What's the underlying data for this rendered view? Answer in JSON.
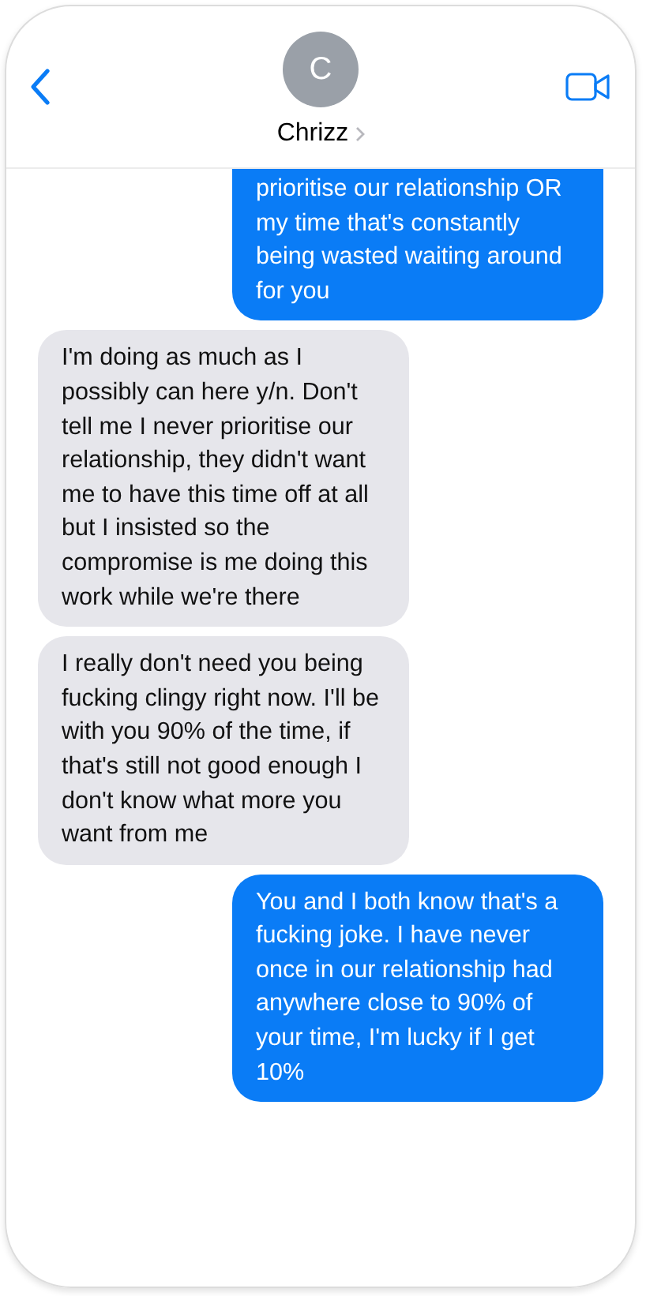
{
  "contact": {
    "initial": "C",
    "name": "Chrizz"
  },
  "messages": [
    {
      "kind": "sent",
      "text": "prioritise our relationship OR my time that's constantly being wasted waiting around for you"
    },
    {
      "kind": "received",
      "text": "I'm doing as much as I possibly can here y/n. Don't tell me I never prioritise our relationship, they didn't want me to have this time off at all but I insisted so the compromise is me doing this work while we're there"
    },
    {
      "kind": "received",
      "text": "I really don't need you being fucking clingy right now. I'll be with you 90% of the time, if that's still not good enough I don't know what more you want from me"
    },
    {
      "kind": "sent",
      "text": "You and I both know that's a fucking joke. I have never once in our relationship had anywhere close to 90% of your time, I'm lucky if I get 10%"
    }
  ]
}
